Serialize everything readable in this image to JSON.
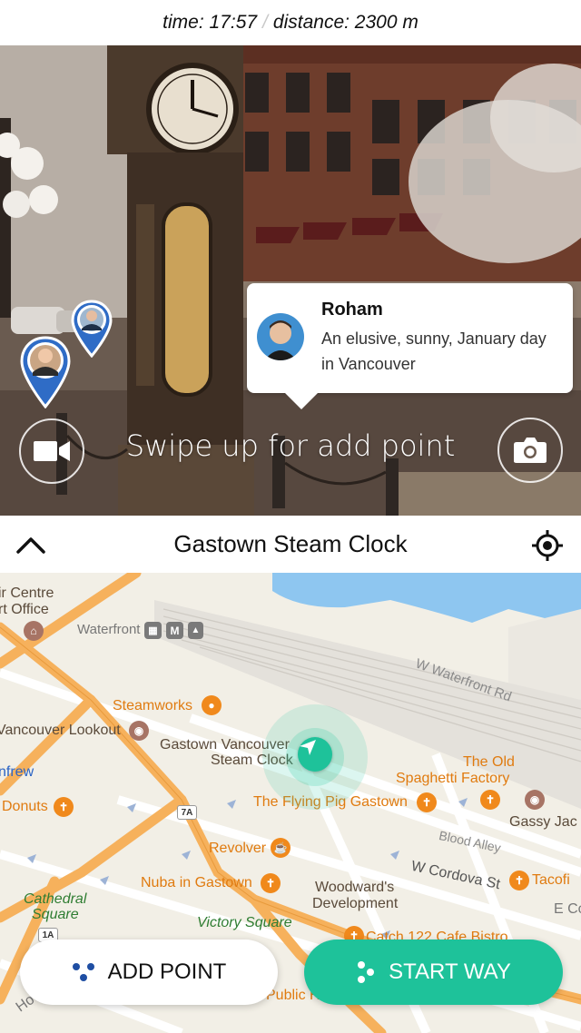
{
  "status": {
    "time_label": "time: 17:57",
    "separator": "/",
    "distance_label": "distance: 2300 m"
  },
  "ar_view": {
    "popup": {
      "name": "Roham",
      "text": "An elusive, sunny, January day in Vancouver"
    },
    "swipe_hint": "Swipe up for add point",
    "icons": {
      "left": "video-camera-icon",
      "right": "camera-icon"
    }
  },
  "place": {
    "title": "Gastown Steam Clock",
    "collapse_icon": "chevron-up-icon",
    "locate_icon": "crosshair-icon"
  },
  "map": {
    "labels": {
      "tourism_centre_1": "ir Centre",
      "tourism_centre_2": "rt Office",
      "waterfront": "Waterfront",
      "metro_badge": "M",
      "w_waterfront_rd": "W Waterfront Rd",
      "steamworks": "Steamworks",
      "vancouver_lookout": "Vancouver Lookout",
      "gastown_clock_1": "Gastown Vancouver",
      "gastown_clock_2": "Steam Clock",
      "the_old_1": "The Old",
      "the_old_2": "Spaghetti Factory",
      "nfrew": "nfrew",
      "donuts": "Donuts",
      "flying_pig": "The Flying Pig Gastown",
      "gassy_jack": "Gassy Jac",
      "route_7a": "7A",
      "blood_alley": "Blood Alley",
      "revolver": "Revolver",
      "w_cordova": "W Cordova St",
      "tacofino": "Tacofi",
      "nuba": "Nuba in Gastown",
      "woodwards_1": "Woodward's",
      "woodwards_2": "Development",
      "e_co": "E Co",
      "cathedral_1": "Cathedral",
      "cathedral_2": "Square",
      "route_1a": "1A",
      "victory_square": "Victory Square",
      "catch_122": "Catch 122 Cafe Bistro",
      "public_h": "Public H",
      "ho": "Ho"
    },
    "colors": {
      "accent": "#1ec29a",
      "road_major": "#f6b15c",
      "water": "#8ec6f0",
      "land": "#f2efe6"
    }
  },
  "actions": {
    "add_point": "ADD POINT",
    "start_way": "START WAY"
  }
}
